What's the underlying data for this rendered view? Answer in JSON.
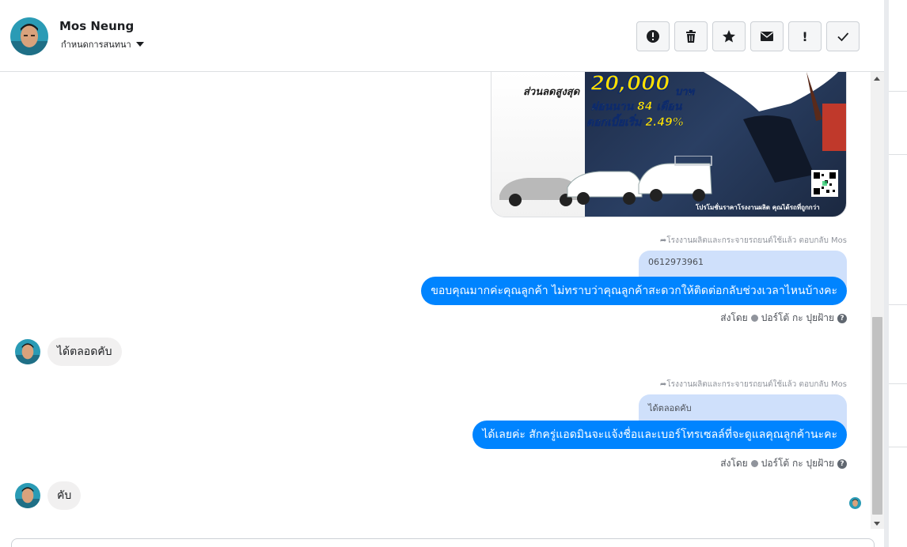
{
  "contact": {
    "name": "Mos Neung",
    "assign_label": "กำหนดการสนทนา"
  },
  "toolbar": {
    "buttons": [
      {
        "icon": "exclamation-circle-icon"
      },
      {
        "icon": "trash-icon"
      },
      {
        "icon": "star-icon"
      },
      {
        "icon": "envelope-icon"
      },
      {
        "icon": "exclamation-icon",
        "label": "!"
      },
      {
        "icon": "checkmark-icon"
      }
    ]
  },
  "ad": {
    "discount_label": "ส่วนลดสูงสุด",
    "discount_amount": "20,000",
    "currency": "บาท",
    "installment": "ผ่อนนาน 84 เดือน",
    "interest": "ดอกเบี้ยเริ่ม 2.49%",
    "footer": "โปรโมชั่นราคาโรงงานผลิต คุณได้รถที่ถูกกว่า"
  },
  "messages": [
    {
      "reply_ref": "โรงงานผลิตและกระจายรถยนต์ใช้แล้ว ตอบกลับ Mos",
      "quoted": "0612973961",
      "text": "ขอบคุณมากค่ะคุณลูกค้า ไม่ทราบว่าคุณลูกค้าสะดวกให้ติดต่อกลับช่วงเวลาไหนบ้างคะ",
      "sent_by_label": "ส่งโดย",
      "sender": "ปอร์โต้ กะ ปุยฝ้าย"
    },
    {
      "incoming": "ได้ตลอดคับ"
    },
    {
      "reply_ref": "โรงงานผลิตและกระจายรถยนต์ใช้แล้ว ตอบกลับ Mos",
      "quoted": "ได้ตลอดคับ",
      "text": "ได้เลยค่ะ สักครู่แอดมินจะแจ้งชื่อและเบอร์โทรเซลล์ที่จะดูแลคุณลูกค้านะคะ",
      "sent_by_label": "ส่งโดย",
      "sender": "ปอร์โต้ กะ ปุยฝ้าย"
    },
    {
      "incoming": "คับ"
    }
  ],
  "colors": {
    "accent": "#0084ff",
    "quote_bg": "#cfe0fb",
    "incoming_bg": "#f1f0f0"
  }
}
